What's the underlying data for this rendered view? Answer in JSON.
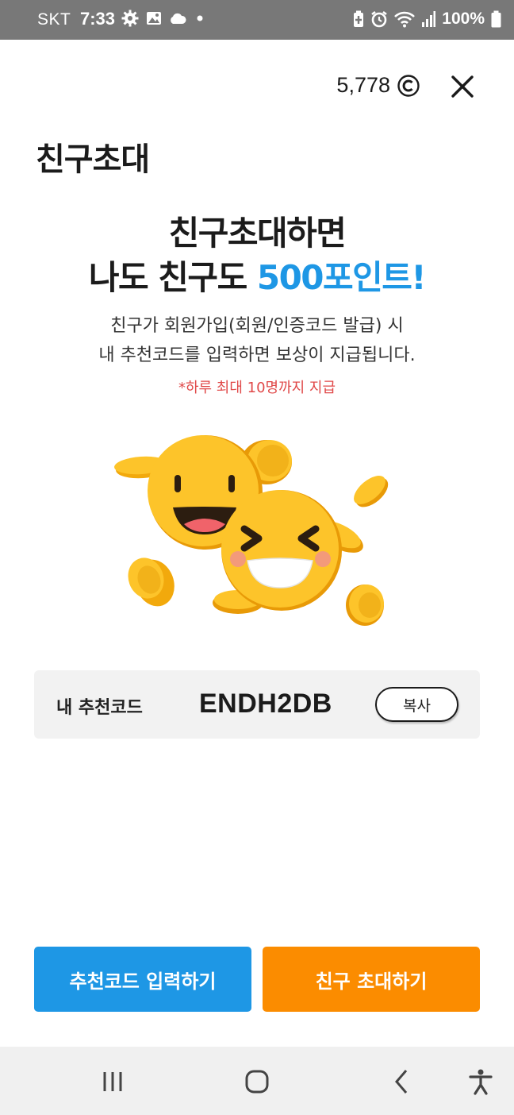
{
  "status_bar": {
    "carrier": "SKT",
    "time": "7:33",
    "battery": "100%",
    "left_icons": [
      "gear-icon",
      "image-icon",
      "cloud-icon",
      "dot-icon"
    ],
    "right_icons": [
      "battery-saver-icon",
      "alarm-icon",
      "wifi-icon",
      "signal-icon",
      "battery-icon"
    ]
  },
  "header": {
    "points": "5,778",
    "points_icon": "coin-c-icon",
    "close_icon": "close-icon"
  },
  "page": {
    "title": "친구초대"
  },
  "promo": {
    "headline_line1": "친구초대하면",
    "headline_line2_prefix": "나도 친구도 ",
    "headline_line2_accent": "500포인트!",
    "desc_line1": "친구가 회원가입(회원/인증코드 발급) 시",
    "desc_line2": "내 추천코드를 입력하면 보상이 지급됩니다.",
    "note": "*하루 최대 10명까지 지급"
  },
  "referral": {
    "label": "내 추천코드",
    "code": "ENDH2DB",
    "copy_label": "복사"
  },
  "actions": {
    "enter_code_label": "추천코드 입력하기",
    "invite_label": "친구 초대하기"
  },
  "nav_bar": {
    "items": [
      "recent-apps-icon",
      "home-icon",
      "back-icon",
      "accessibility-icon"
    ]
  },
  "colors": {
    "accent_blue": "#1e97e5",
    "accent_orange": "#fb8c00",
    "note_red": "#e04848",
    "status_bar": "#787878",
    "card_bg": "#f2f2f2",
    "coin_yellow": "#fdc42a"
  }
}
